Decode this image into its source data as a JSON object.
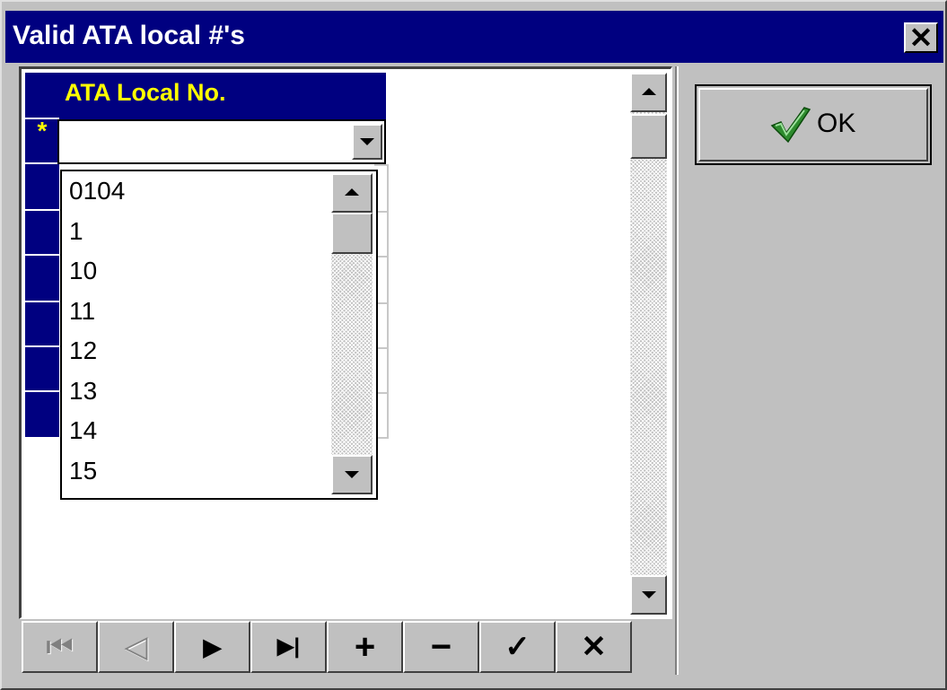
{
  "window": {
    "title": "Valid ATA local #'s",
    "close_label": "✕"
  },
  "grid": {
    "column_header": "ATA Local No.",
    "new_row_marker": "*",
    "edit_value": ""
  },
  "dropdown": {
    "items": [
      "0104",
      "1",
      "10",
      "11",
      "12",
      "13",
      "14",
      "15"
    ]
  },
  "navigator": {
    "first": "⏮",
    "prior": "◁",
    "next": "▶",
    "last": "▶|",
    "insert": "+",
    "delete": "−",
    "post": "✓",
    "cancel": "✕"
  },
  "ok_button": {
    "label": "OK",
    "icon": "check-icon",
    "icon_color": "#2e8b2e"
  }
}
